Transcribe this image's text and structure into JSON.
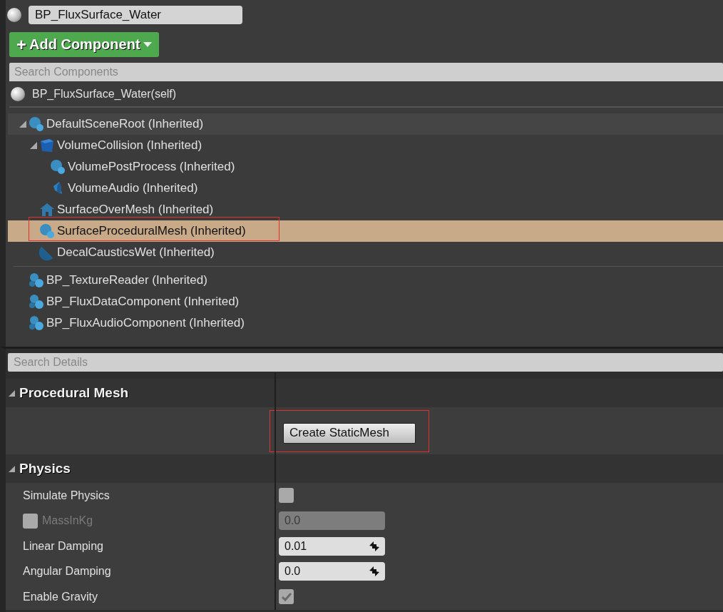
{
  "blueprint": {
    "name": "BP_FluxSurface_Water"
  },
  "add_component_button": {
    "icon": "+",
    "label": "Add Component"
  },
  "component_search": {
    "placeholder": "Search Components"
  },
  "self_item": {
    "label": "BP_FluxSurface_Water(self)"
  },
  "scene_tree": [
    {
      "label": "DefaultSceneRoot (Inherited)",
      "kind": "scene",
      "expanded": true,
      "selected": false,
      "highlighted": false,
      "children": [
        {
          "label": "VolumeCollision (Inherited)",
          "kind": "box",
          "expanded": true,
          "selected": false,
          "highlighted": false,
          "children": [
            {
              "label": "VolumePostProcess (Inherited)",
              "kind": "scene",
              "selected": false,
              "highlighted": false
            },
            {
              "label": "VolumeAudio (Inherited)",
              "kind": "audio",
              "selected": false,
              "highlighted": false
            }
          ]
        },
        {
          "label": "SurfaceOverMesh (Inherited)",
          "kind": "house",
          "selected": false,
          "highlighted": false
        },
        {
          "label": "SurfaceProceduralMesh (Inherited)",
          "kind": "scene",
          "selected": true,
          "highlighted": true
        },
        {
          "label": "DecalCausticsWet (Inherited)",
          "kind": "decal",
          "selected": false,
          "highlighted": false
        }
      ]
    }
  ],
  "actor_components": [
    {
      "label": "BP_TextureReader (Inherited)",
      "selected": false
    },
    {
      "label": "BP_FluxDataComponent (Inherited)",
      "selected": false
    },
    {
      "label": "BP_FluxAudioComponent (Inherited)",
      "selected": false
    }
  ],
  "details_search": {
    "placeholder": "Search Details"
  },
  "sections": [
    {
      "title": "Procedural Mesh",
      "expanded": true,
      "rows": [
        {
          "kind": "button",
          "label": "Create StaticMesh",
          "highlighted": true
        }
      ]
    },
    {
      "title": "Physics",
      "expanded": true,
      "rows": [
        {
          "kind": "checkbox",
          "label": "Simulate Physics",
          "checked": false
        },
        {
          "kind": "override_number",
          "label": "MassInKg",
          "checked": false,
          "value": "0.0",
          "disabled": true
        },
        {
          "kind": "spin_number",
          "label": "Linear Damping",
          "value": "0.01"
        },
        {
          "kind": "spin_number",
          "label": "Angular Damping",
          "value": "0.0"
        },
        {
          "kind": "checkbox",
          "label": "Enable Gravity",
          "checked": true
        }
      ]
    }
  ]
}
